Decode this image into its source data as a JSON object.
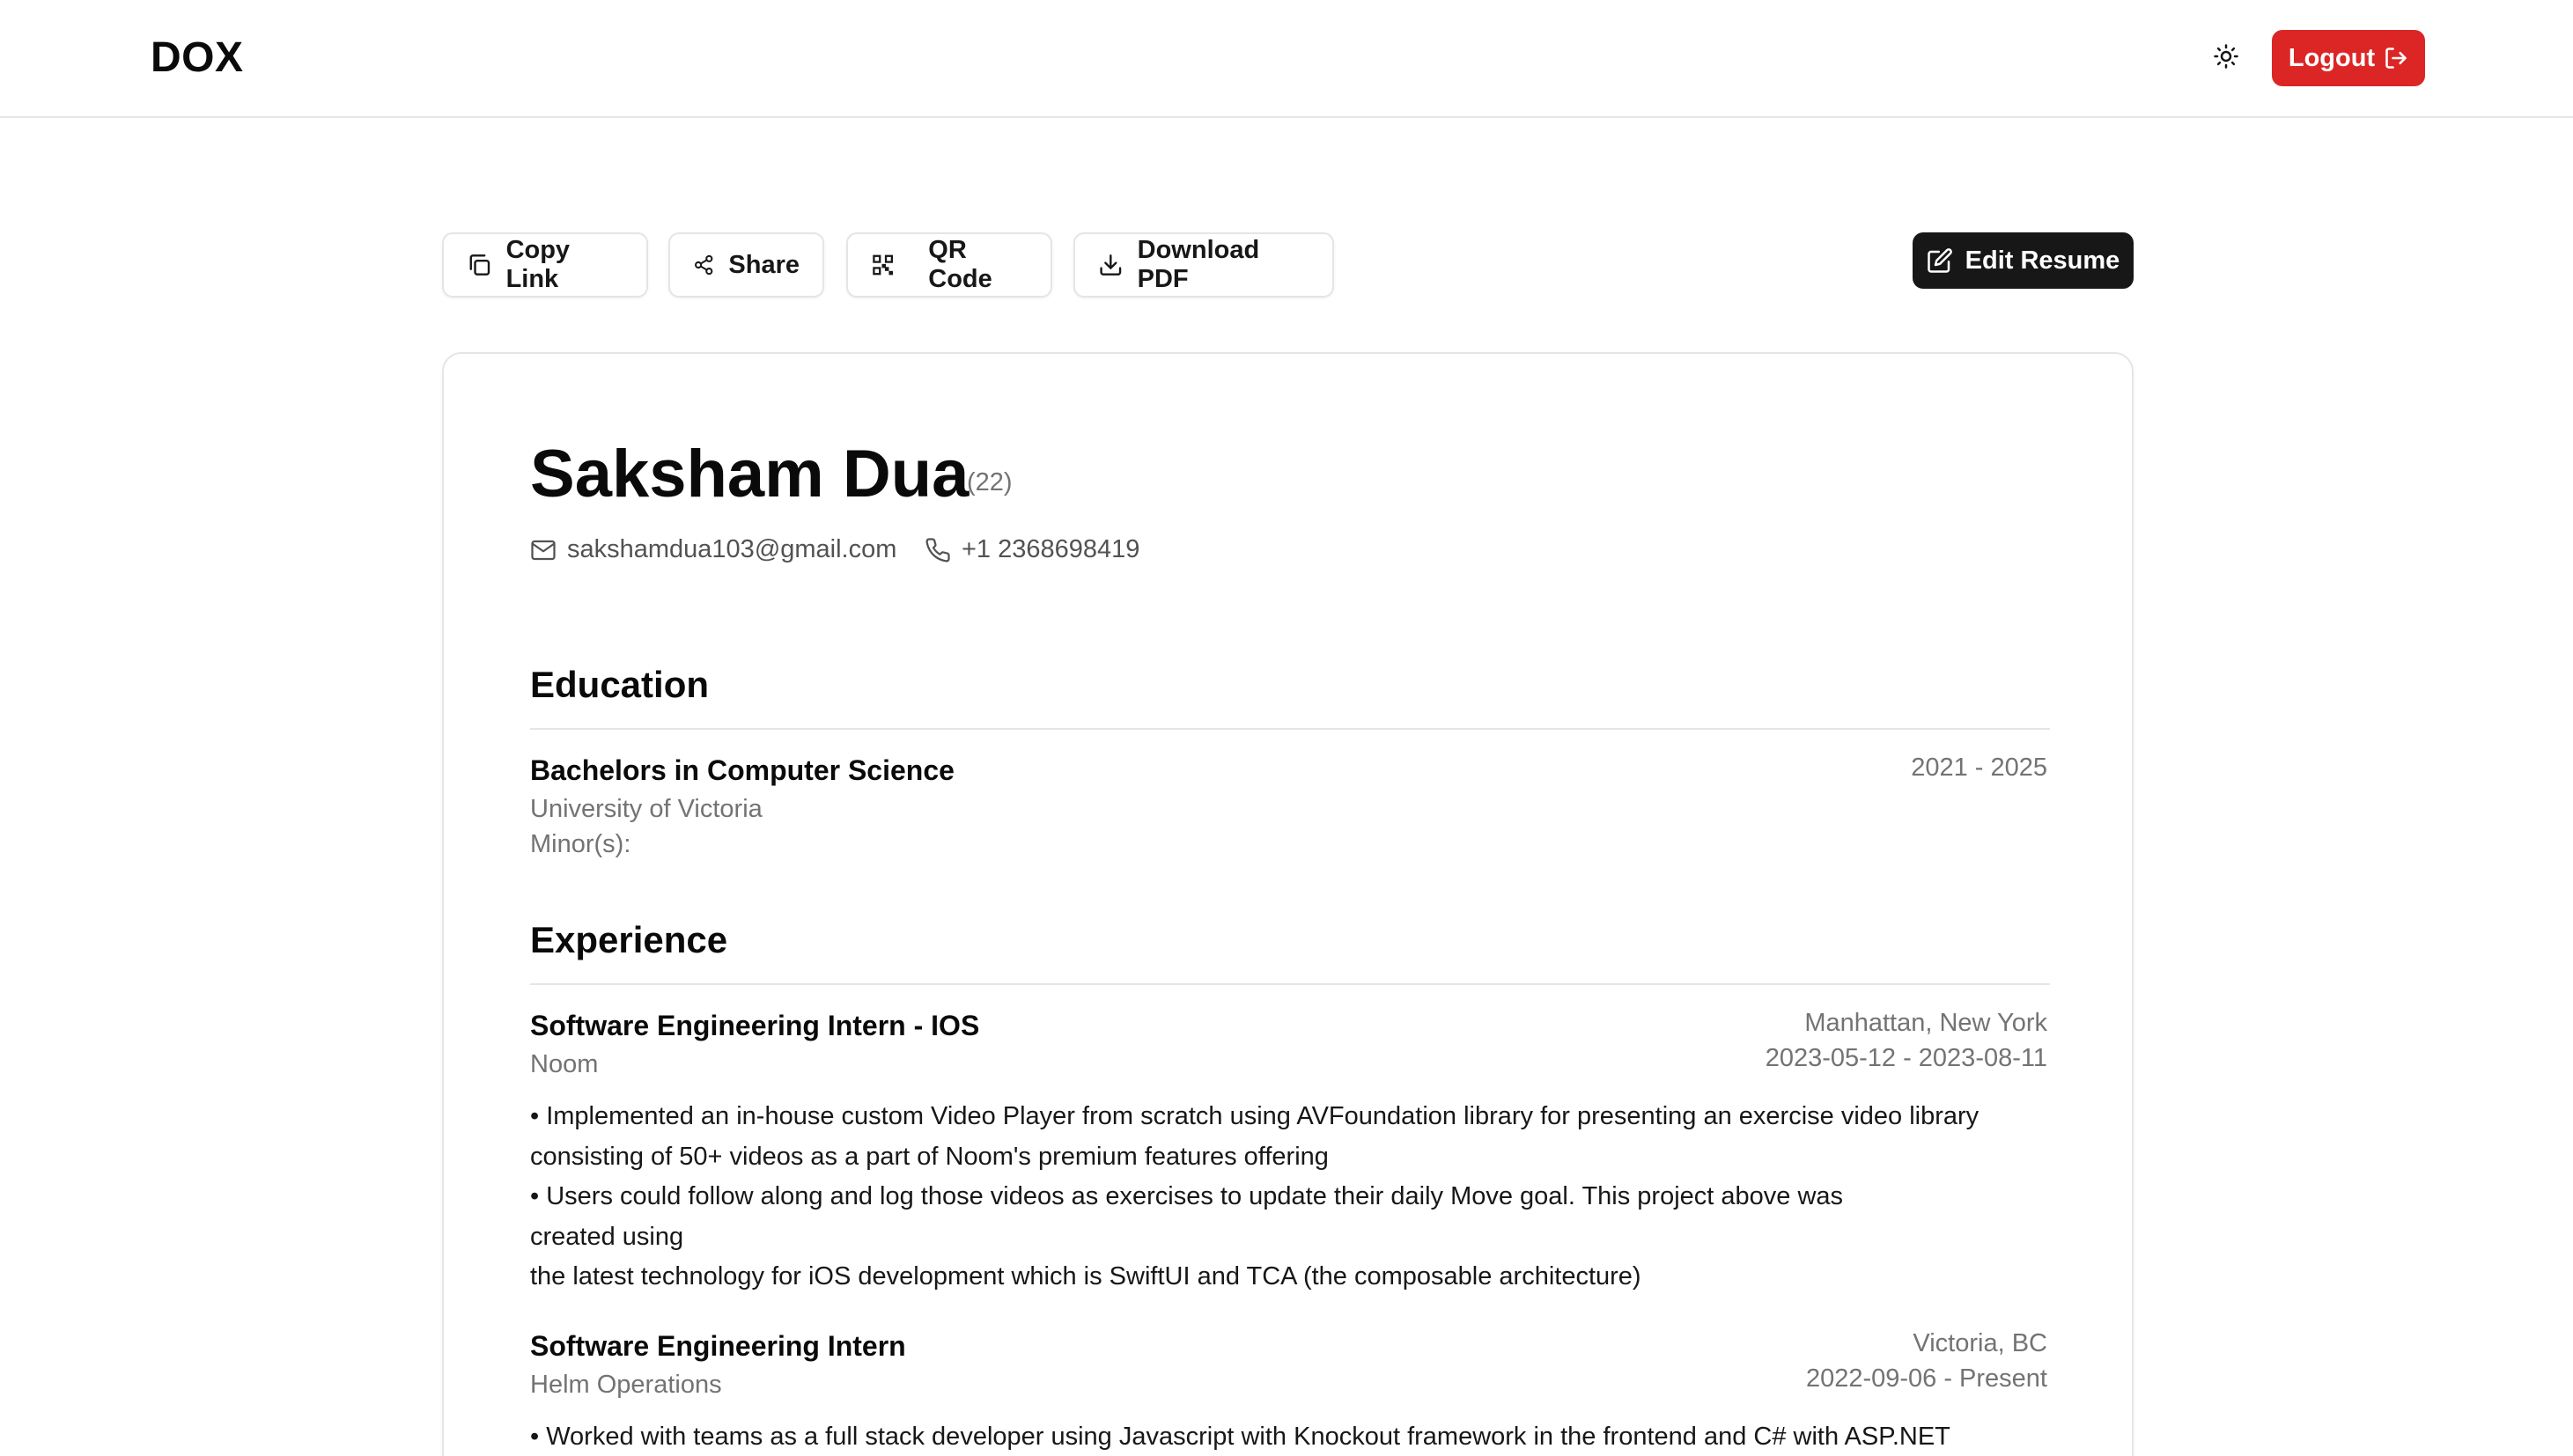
{
  "header": {
    "logo": "DOX",
    "theme_icon": "sun-icon",
    "logout_label": "Logout",
    "logout_icon": "logout-arrow-icon"
  },
  "toolbar": {
    "copy_link": "Copy Link",
    "share": "Share",
    "qr_code": "QR Code",
    "download_pdf": "Download PDF",
    "edit_resume": "Edit Resume"
  },
  "profile": {
    "name": "Saksham Dua",
    "age": "(22)",
    "email": "sakshamdua103@gmail.com",
    "phone": "+1 2368698419"
  },
  "education": {
    "title": "Education",
    "items": [
      {
        "degree": "Bachelors in Computer Science",
        "school": "University of Victoria",
        "minors": "Minor(s):",
        "years": "2021 - 2025"
      }
    ]
  },
  "experience": {
    "title": "Experience",
    "items": [
      {
        "role": "Software Engineering Intern - IOS",
        "company": "Noom",
        "location": "Manhattan, New York",
        "dates": "2023-05-12 - 2023-08-11",
        "lines": [
          "• Implemented an in-house custom Video Player from scratch using AVFoundation library for presenting an exercise video library",
          "consisting of 50+ videos as a part of Noom's premium features offering",
          "• Users could follow along and log those videos as exercises to update their daily Move goal. This project above was",
          "created using",
          "the latest technology for iOS development which is SwiftUI and TCA (the composable architecture)"
        ]
      },
      {
        "role": "Software Engineering Intern",
        "company": "Helm Operations",
        "location": "Victoria, BC",
        "dates": "2022-09-06 - Present",
        "lines": [
          "• Worked with teams as a full stack developer using Javascript with Knockout framework in the frontend and C# with ASP.NET"
        ]
      }
    ]
  },
  "colors": {
    "logout_bg": "#dc2626",
    "edit_bg": "#171717",
    "border": "#e5e5e5",
    "muted_text": "#737373"
  }
}
